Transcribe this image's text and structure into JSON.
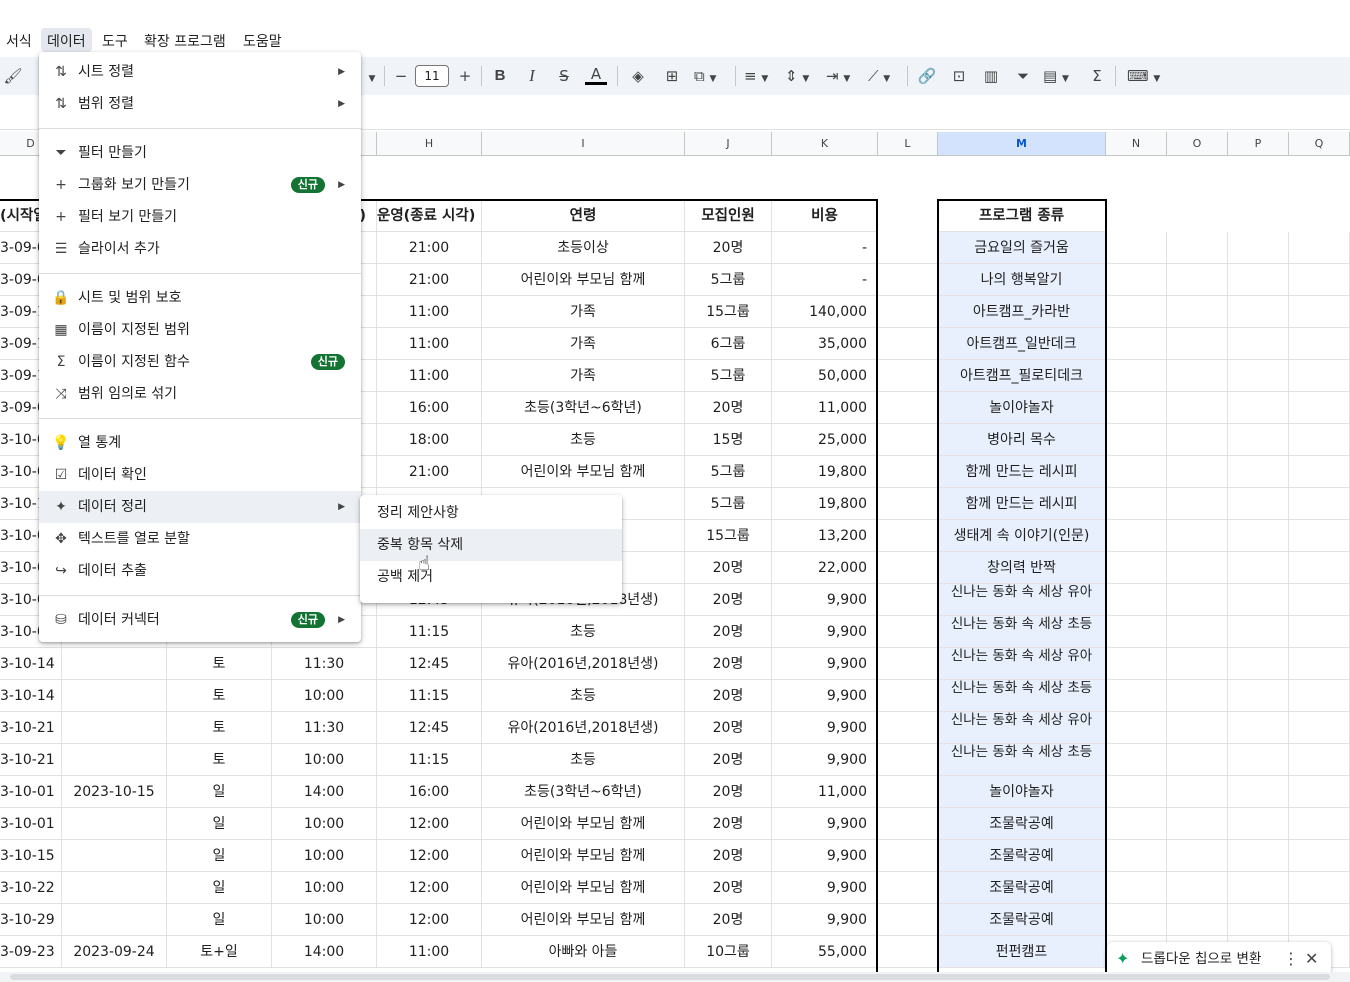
{
  "menubar": {
    "items": [
      {
        "label": "서식"
      },
      {
        "label": "데이터"
      },
      {
        "label": "도구"
      },
      {
        "label": "확장 프로그램"
      },
      {
        "label": "도움말"
      }
    ],
    "active_index": 1
  },
  "toolbar": {
    "font_size": "11",
    "icons": [
      "paint-format-icon",
      "minus-icon",
      "plus-icon",
      "bold-icon",
      "italic-icon",
      "strikethrough-icon",
      "text-color-icon",
      "fill-color-icon",
      "borders-icon",
      "merge-cells-icon",
      "align-horizontal-icon",
      "align-vertical-icon",
      "text-wrap-icon",
      "text-rotate-icon",
      "link-icon",
      "comment-icon",
      "chart-icon",
      "filter-icon",
      "filter-views-icon",
      "functions-icon",
      "input-tools-icon"
    ],
    "labels": {
      "minus": "−",
      "plus": "+",
      "bold": "B",
      "italic": "I",
      "strike": "S",
      "text_color": "A",
      "functions": "Σ"
    }
  },
  "grid": {
    "columns": [
      "D",
      "H",
      "I",
      "J",
      "K",
      "L",
      "M",
      "N",
      "O",
      "P",
      "Q"
    ],
    "selected_column": "M",
    "header_row": {
      "D": "(시작일",
      "G": "각)",
      "H": "운영(종료 시각)",
      "I": "연령",
      "J": "모집인원",
      "K": "비용",
      "M": "프로그램 종류"
    },
    "rows": [
      {
        "D": "3-09-0",
        "E": "",
        "F": "",
        "G": "",
        "H": "21:00",
        "I": "초등이상",
        "J": "20명",
        "K": "-",
        "M": "금요일의 즐거움"
      },
      {
        "D": "3-09-0",
        "E": "",
        "F": "",
        "G": "",
        "H": "21:00",
        "I": "어린이와 부모님 함께",
        "J": "5그룹",
        "K": "-",
        "M": "나의 행복알기"
      },
      {
        "D": "3-09-1",
        "E": "",
        "F": "",
        "G": "",
        "H": "11:00",
        "I": "가족",
        "J": "15그룹",
        "K": "140,000",
        "M": "아트캠프_카라반"
      },
      {
        "D": "3-09-1",
        "E": "",
        "F": "",
        "G": "",
        "H": "11:00",
        "I": "가족",
        "J": "6그룹",
        "K": "35,000",
        "M": "아트캠프_일반데크"
      },
      {
        "D": "3-09-1",
        "E": "",
        "F": "",
        "G": "",
        "H": "11:00",
        "I": "가족",
        "J": "5그룹",
        "K": "50,000",
        "M": "아트캠프_필로티데크"
      },
      {
        "D": "3-09-0",
        "E": "",
        "F": "",
        "G": "",
        "H": "16:00",
        "I": "초등(3학년~6학년)",
        "J": "20명",
        "K": "11,000",
        "M": "놀이야놀자"
      },
      {
        "D": "3-10-0",
        "E": "",
        "F": "",
        "G": "",
        "H": "18:00",
        "I": "초등",
        "J": "15명",
        "K": "25,000",
        "M": "병아리 목수"
      },
      {
        "D": "3-10-0",
        "E": "",
        "F": "",
        "G": "",
        "H": "21:00",
        "I": "어린이와 부모님 함께",
        "J": "5그룹",
        "K": "19,800",
        "M": "함께 만드는 레시피"
      },
      {
        "D": "3-10-1",
        "E": "",
        "F": "",
        "G": "",
        "H": "",
        "I": "함께",
        "J": "5그룹",
        "K": "19,800",
        "M": "함께 만드는 레시피"
      },
      {
        "D": "3-10-0",
        "E": "",
        "F": "",
        "G": "",
        "H": "",
        "I": "~2016년)",
        "J": "15그룹",
        "K": "13,200",
        "M": "생태계 속 이야기(인문)"
      },
      {
        "D": "3-10-0",
        "E": "",
        "F": "",
        "G": "",
        "H": "",
        "I": "년)",
        "J": "20명",
        "K": "22,000",
        "M": "창의력 반짝"
      },
      {
        "D": "3-10-0",
        "E": "",
        "F": "",
        "G": "",
        "H": "12:45",
        "I": "유아(2016년,2018년생)",
        "J": "20명",
        "K": "9,900",
        "M": "신나는 동화 속 세상_유아"
      },
      {
        "D": "3-10-0",
        "E": "",
        "F": "",
        "G": "",
        "H": "11:15",
        "I": "초등",
        "J": "20명",
        "K": "9,900",
        "M": "신나는 동화 속 세상_초등"
      },
      {
        "D": "3-10-14",
        "E": "",
        "F": "토",
        "G": "11:30",
        "H": "12:45",
        "I": "유아(2016년,2018년생)",
        "J": "20명",
        "K": "9,900",
        "M": "신나는 동화 속 세상_유아"
      },
      {
        "D": "3-10-14",
        "E": "",
        "F": "토",
        "G": "10:00",
        "H": "11:15",
        "I": "초등",
        "J": "20명",
        "K": "9,900",
        "M": "신나는 동화 속 세상_초등"
      },
      {
        "D": "3-10-21",
        "E": "",
        "F": "토",
        "G": "11:30",
        "H": "12:45",
        "I": "유아(2016년,2018년생)",
        "J": "20명",
        "K": "9,900",
        "M": "신나는 동화 속 세상_유아"
      },
      {
        "D": "3-10-21",
        "E": "",
        "F": "토",
        "G": "10:00",
        "H": "11:15",
        "I": "초등",
        "J": "20명",
        "K": "9,900",
        "M": "신나는 동화 속 세상_초등"
      },
      {
        "D": "3-10-01",
        "E": "2023-10-15",
        "F": "일",
        "G": "14:00",
        "H": "16:00",
        "I": "초등(3학년~6학년)",
        "J": "20명",
        "K": "11,000",
        "M": "놀이야놀자"
      },
      {
        "D": "3-10-01",
        "E": "",
        "F": "일",
        "G": "10:00",
        "H": "12:00",
        "I": "어린이와 부모님 함께",
        "J": "20명",
        "K": "9,900",
        "M": "조물락공예"
      },
      {
        "D": "3-10-15",
        "E": "",
        "F": "일",
        "G": "10:00",
        "H": "12:00",
        "I": "어린이와 부모님 함께",
        "J": "20명",
        "K": "9,900",
        "M": "조물락공예"
      },
      {
        "D": "3-10-22",
        "E": "",
        "F": "일",
        "G": "10:00",
        "H": "12:00",
        "I": "어린이와 부모님 함께",
        "J": "20명",
        "K": "9,900",
        "M": "조물락공예"
      },
      {
        "D": "3-10-29",
        "E": "",
        "F": "일",
        "G": "10:00",
        "H": "12:00",
        "I": "어린이와 부모님 함께",
        "J": "20명",
        "K": "9,900",
        "M": "조물락공예"
      },
      {
        "D": "3-09-23",
        "E": "2023-09-24",
        "F": "토+일",
        "G": "14:00",
        "H": "11:00",
        "I": "아빠와 아들",
        "J": "10그룹",
        "K": "55,000",
        "M": "펀펀캠프"
      }
    ]
  },
  "data_menu": {
    "items": [
      {
        "icon": "sort-icon",
        "label": "시트 정렬",
        "submenu": true
      },
      {
        "icon": "sort-icon",
        "label": "범위 정렬",
        "submenu": true
      },
      {
        "icon": "filter-icon",
        "label": "필터 만들기"
      },
      {
        "icon": "plus-icon",
        "label": "그룹화 보기 만들기",
        "submenu": true,
        "badge": "신규"
      },
      {
        "icon": "plus-icon",
        "label": "필터 보기 만들기"
      },
      {
        "icon": "slicer-icon",
        "label": "슬라이서 추가"
      },
      {
        "icon": "lock-icon",
        "label": "시트 및 범위 보호"
      },
      {
        "icon": "table-icon",
        "label": "이름이 지정된 범위"
      },
      {
        "icon": "sigma-icon",
        "label": "이름이 지정된 함수",
        "badge": "신규"
      },
      {
        "icon": "shuffle-icon",
        "label": "범위 임의로 섞기"
      },
      {
        "icon": "lightbulb-icon",
        "label": "열 통계"
      },
      {
        "icon": "validation-icon",
        "label": "데이터 확인"
      },
      {
        "icon": "magic-wand-icon",
        "label": "데이터 정리",
        "submenu": true
      },
      {
        "icon": "split-icon",
        "label": "텍스트를 열로 분할"
      },
      {
        "icon": "extract-icon",
        "label": "데이터 추출"
      },
      {
        "icon": "database-icon",
        "label": "데이터 커넥터",
        "submenu": true,
        "badge": "신규"
      }
    ]
  },
  "cleanup_submenu": {
    "items": [
      {
        "label": "정리 제안사항"
      },
      {
        "label": "중복 항목 삭제"
      },
      {
        "label": "공백 제거"
      }
    ]
  },
  "toast": {
    "text": "드롭다운 칩으로 변환"
  },
  "colors": {
    "accent": "#0b57d0",
    "badge": "#137333",
    "selected_col_bg": "#e8f0fe",
    "toolbar_bg": "#f0f4f9"
  }
}
